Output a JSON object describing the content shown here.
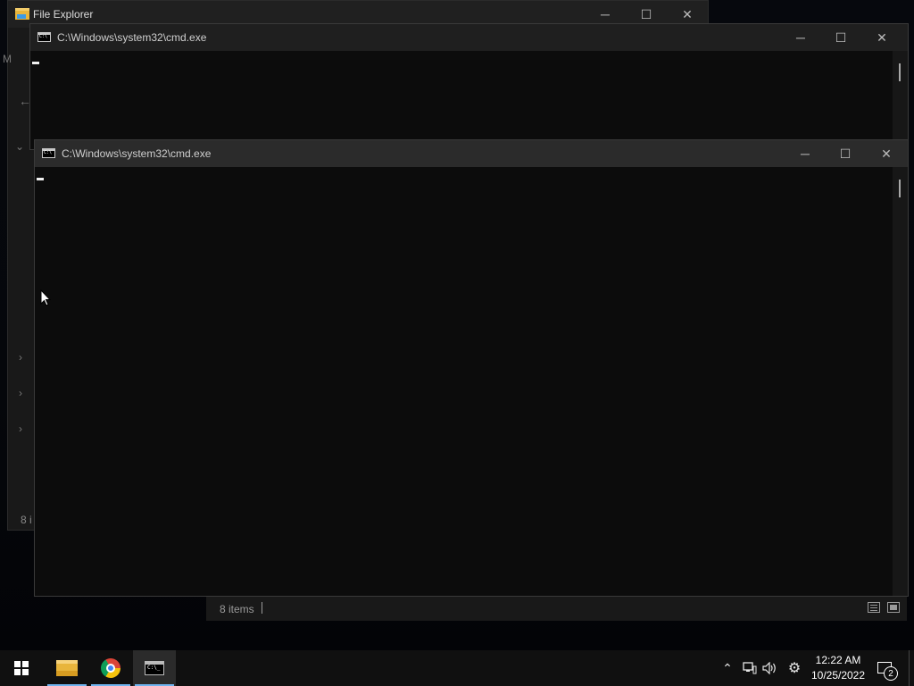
{
  "file_explorer": {
    "title": "File Explorer",
    "left_glyph": "M",
    "status_partial": "8 i",
    "status_items": "8 items"
  },
  "cmd_back": {
    "title": "C:\\Windows\\system32\\cmd.exe"
  },
  "cmd_front": {
    "title": "C:\\Windows\\system32\\cmd.exe"
  },
  "window_controls": {
    "minimize": "─",
    "maximize": "☐",
    "close": "✕"
  },
  "taskbar": {
    "pinned": [
      "start-button",
      "file-explorer",
      "google-chrome",
      "command-prompt"
    ],
    "clock_time": "12:22 AM",
    "clock_date": "10/25/2022",
    "notification_count": "2",
    "tray_icons": [
      "chevron-up-icon",
      "network-icon",
      "volume-icon",
      "settings-icon"
    ]
  },
  "colors": {
    "taskbar": "#101010",
    "accent": "#6fb3ee",
    "console_bg": "#0c0c0c"
  }
}
